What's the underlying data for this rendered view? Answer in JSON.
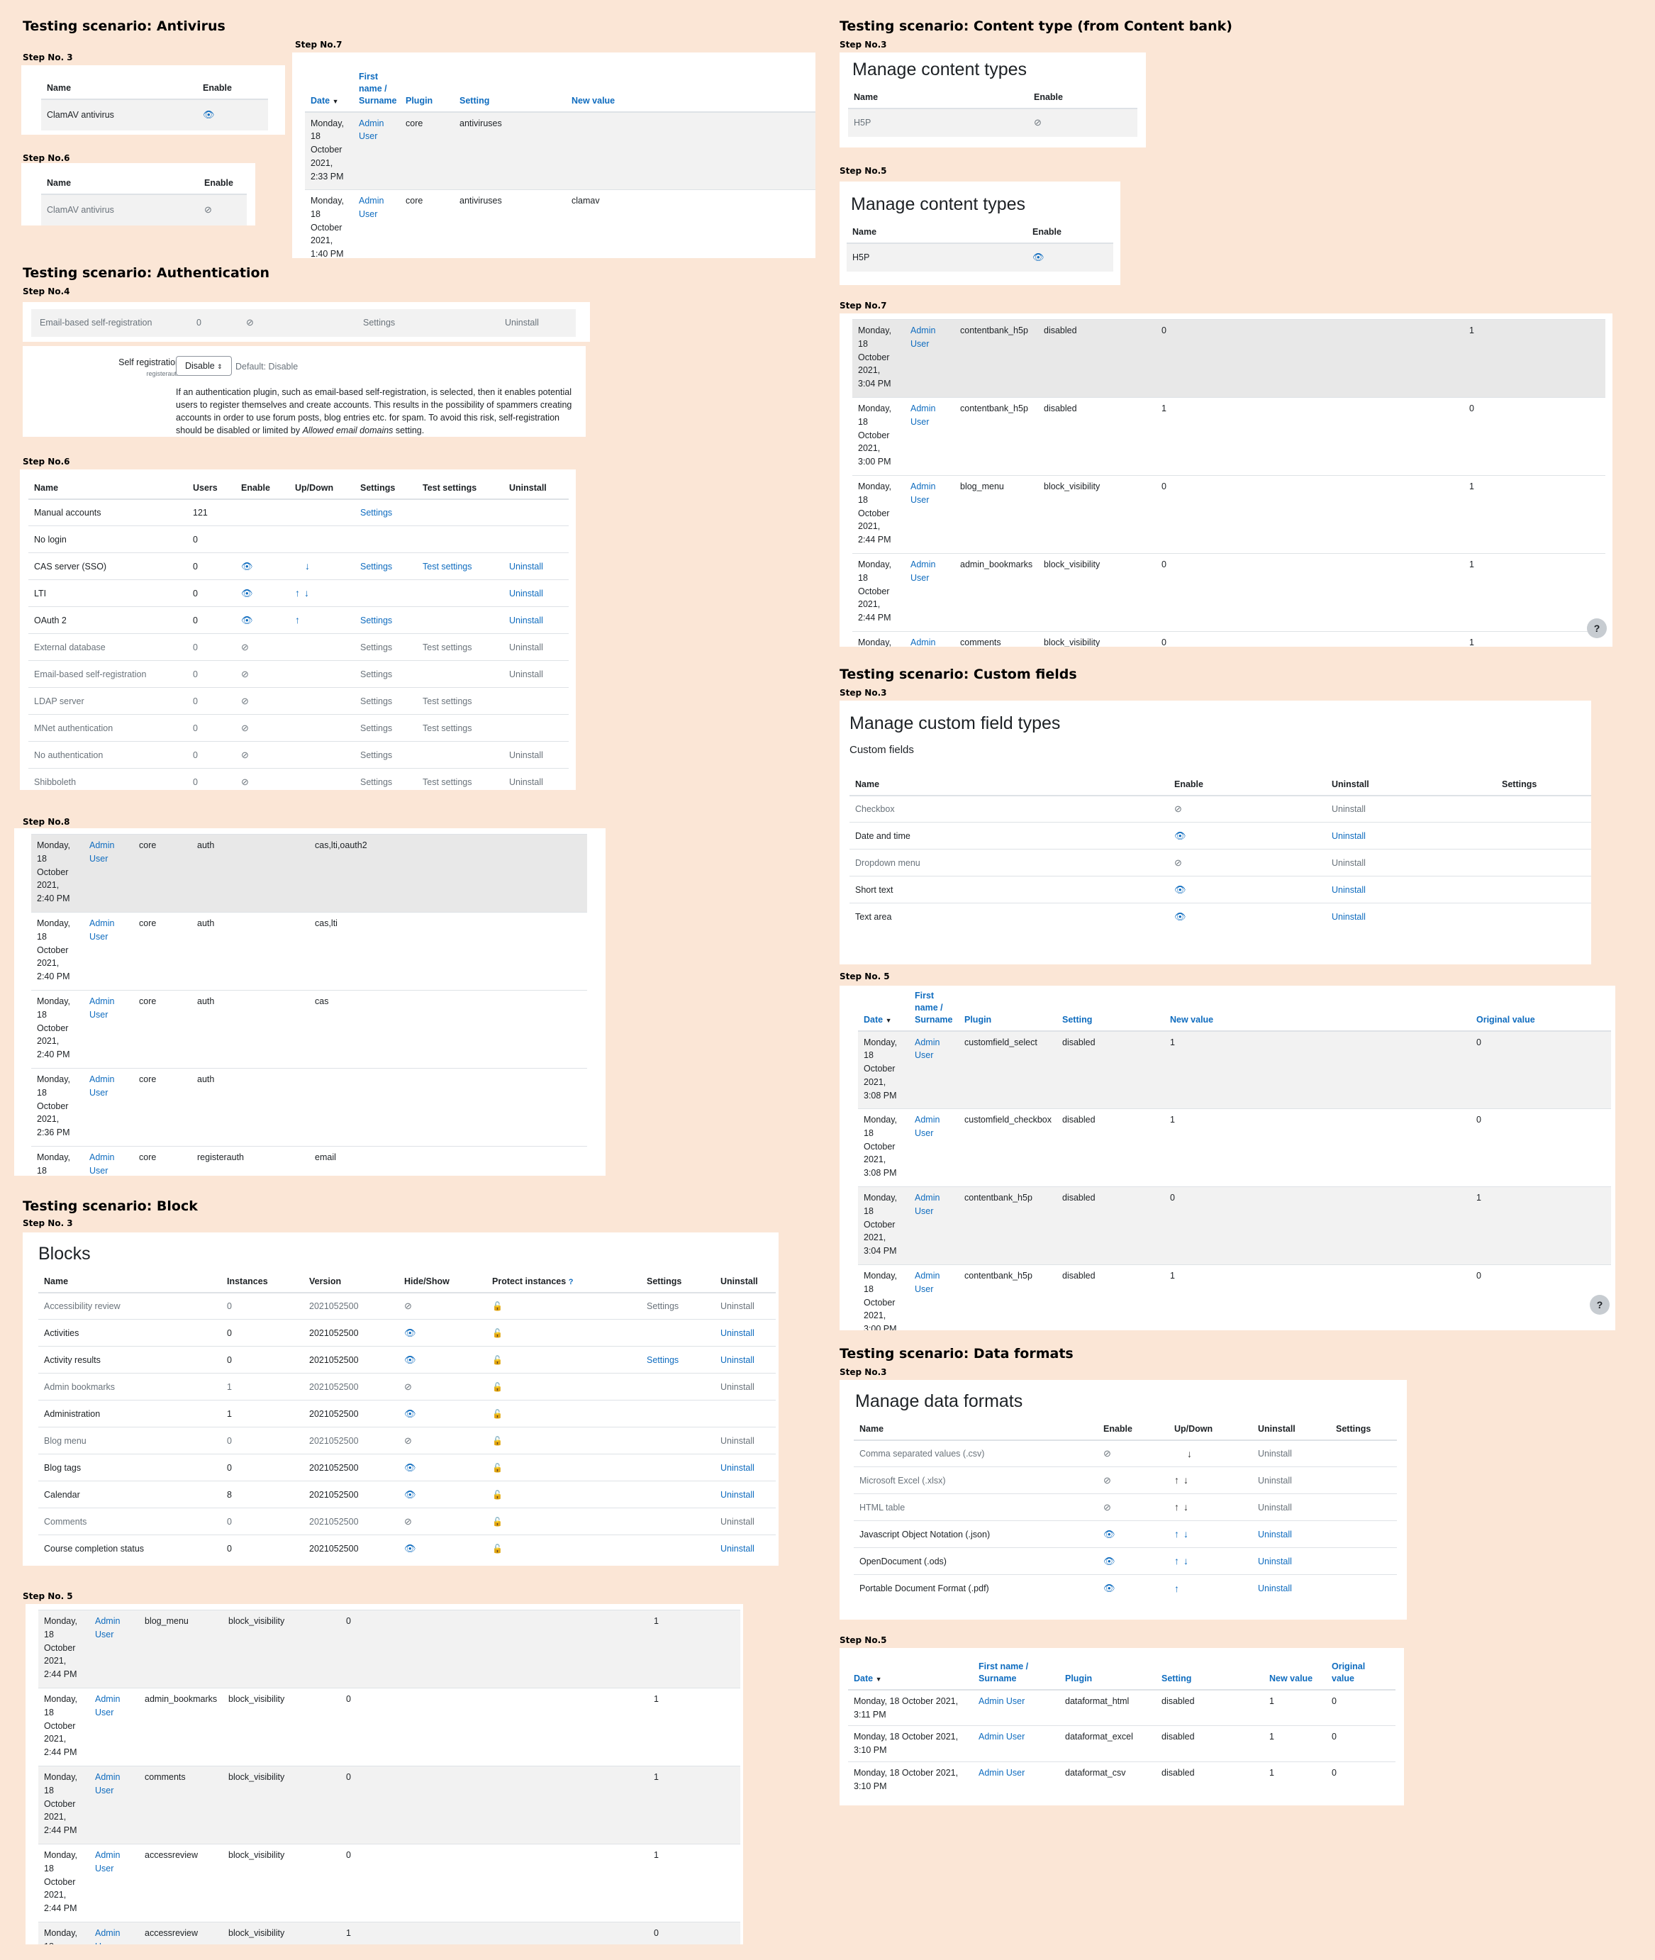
{
  "sections": {
    "antivirus": "Testing scenario: Antivirus",
    "auth": "Testing scenario: Authentication",
    "block": "Testing scenario: Block",
    "content": "Testing scenario: Content type (from Content bank)",
    "custom": "Testing scenario: Custom fields",
    "dataformats": "Testing scenario: Data formats"
  },
  "steps": {
    "av3": "Step No. 3",
    "av6": "Step No.6",
    "av7": "Step No.7",
    "au4": "Step No.4",
    "au6": "Step No.6",
    "au8": "Step No.8",
    "bl3": "Step No. 3",
    "bl5": "Step No. 5",
    "ct3": "Step No.3",
    "ct5": "Step No.5",
    "ct7": "Step No.7",
    "cf3": "Step No.3",
    "cf5": "Step No. 5",
    "df3": "Step No.3",
    "df5": "Step No.5"
  },
  "common": {
    "name": "Name",
    "enable": "Enable",
    "uninstall": "Uninstall",
    "settings": "Settings",
    "test_settings": "Test settings",
    "admin_user": "Admin User",
    "admin": "Admin",
    "user": "User",
    "monday": "Monday,",
    "day": "18",
    "month": "October",
    "year": "2021,",
    "help": "?"
  },
  "log_headers": {
    "date": "Date",
    "first_name": "First name / Surname",
    "plugin": "Plugin",
    "setting": "Setting",
    "new_value": "New value",
    "original_value": "Original value"
  },
  "antivirus": {
    "step3": {
      "row": "ClamAV antivirus"
    },
    "step6": {
      "row": "ClamAV antivirus"
    },
    "step7": {
      "rows": [
        {
          "time": "2:33 PM",
          "plugin": "core",
          "setting": "antiviruses",
          "value": ""
        },
        {
          "time": "1:40 PM",
          "plugin": "core",
          "setting": "antiviruses",
          "value": "clamav"
        }
      ]
    }
  },
  "auth": {
    "step4": {
      "name": "Email-based self-registration",
      "users": "0",
      "settings": "Settings",
      "uninstall": "Uninstall",
      "label": "Self registration",
      "sublabel": "registerauth",
      "select_value": "Disable",
      "default": "Default: Disable",
      "desc1": "If an authentication plugin, such as email-based self-registration, is selected, then it enables potential users to register themselves and create accounts. This results in the possibility of spammers creating accounts in order to use forum posts, blog entries etc. for spam. To avoid this risk, self-registration should be disabled or limited by",
      "desc_em": "Allowed email domains",
      "desc2": "setting."
    },
    "step6": {
      "headers": {
        "name": "Name",
        "users": "Users",
        "enable": "Enable",
        "updown": "Up/Down",
        "settings": "Settings",
        "test": "Test settings",
        "uninstall": "Uninstall"
      },
      "rows": [
        {
          "name": "Manual accounts",
          "users": "121"
        },
        {
          "name": "No login",
          "users": "0"
        },
        {
          "name": "CAS server (SSO)",
          "users": "0"
        },
        {
          "name": "LTI",
          "users": "0"
        },
        {
          "name": "OAuth 2",
          "users": "0"
        },
        {
          "name": "External database",
          "users": "0"
        },
        {
          "name": "Email-based self-registration",
          "users": "0"
        },
        {
          "name": "LDAP server",
          "users": "0"
        },
        {
          "name": "MNet authentication",
          "users": "0"
        },
        {
          "name": "No authentication",
          "users": "0"
        },
        {
          "name": "Shibboleth",
          "users": "0"
        }
      ]
    },
    "step8": {
      "rows": [
        {
          "time": "2:40 PM",
          "plugin": "core",
          "setting": "auth",
          "value": "cas,lti,oauth2"
        },
        {
          "time": "2:40 PM",
          "plugin": "core",
          "setting": "auth",
          "value": "cas,lti"
        },
        {
          "time": "2:40 PM",
          "plugin": "core",
          "setting": "auth",
          "value": "cas"
        },
        {
          "time": "2:36 PM",
          "plugin": "core",
          "setting": "auth",
          "value": ""
        },
        {
          "time": "",
          "plugin": "core",
          "setting": "registerauth",
          "value": "email"
        }
      ]
    }
  },
  "blocks": {
    "title": "Blocks",
    "headers": {
      "name": "Name",
      "instances": "Instances",
      "version": "Version",
      "hide": "Hide/Show",
      "protect": "Protect instances",
      "settings": "Settings",
      "uninstall": "Uninstall"
    },
    "rows": [
      {
        "name": "Accessibility review",
        "instances": "0",
        "version": "2021052500"
      },
      {
        "name": "Activities",
        "instances": "0",
        "version": "2021052500"
      },
      {
        "name": "Activity results",
        "instances": "0",
        "version": "2021052500"
      },
      {
        "name": "Admin bookmarks",
        "instances": "1",
        "version": "2021052500"
      },
      {
        "name": "Administration",
        "instances": "1",
        "version": "2021052500"
      },
      {
        "name": "Blog menu",
        "instances": "0",
        "version": "2021052500"
      },
      {
        "name": "Blog tags",
        "instances": "0",
        "version": "2021052500"
      },
      {
        "name": "Calendar",
        "instances": "8",
        "version": "2021052500"
      },
      {
        "name": "Comments",
        "instances": "0",
        "version": "2021052500"
      },
      {
        "name": "Course completion status",
        "instances": "0",
        "version": "2021052500"
      }
    ],
    "step5": {
      "rows": [
        {
          "time": "2:44 PM",
          "plugin": "blog_menu",
          "setting": "block_visibility",
          "new": "0",
          "orig": "1"
        },
        {
          "time": "2:44 PM",
          "plugin": "admin_bookmarks",
          "setting": "block_visibility",
          "new": "0",
          "orig": "1"
        },
        {
          "time": "2:44 PM",
          "plugin": "comments",
          "setting": "block_visibility",
          "new": "0",
          "orig": "1"
        },
        {
          "time": "2:44 PM",
          "plugin": "accessreview",
          "setting": "block_visibility",
          "new": "0",
          "orig": "1"
        },
        {
          "time": "",
          "plugin": "accessreview",
          "setting": "block_visibility",
          "new": "1",
          "orig": "0"
        }
      ]
    }
  },
  "content": {
    "title": "Manage content types",
    "row": "H5P",
    "step7": {
      "rows": [
        {
          "time": "3:04 PM",
          "plugin": "contentbank_h5p",
          "setting": "disabled",
          "new": "0",
          "orig": "1"
        },
        {
          "time": "3:00 PM",
          "plugin": "contentbank_h5p",
          "setting": "disabled",
          "new": "1",
          "orig": "0"
        },
        {
          "time": "2:44 PM",
          "plugin": "blog_menu",
          "setting": "block_visibility",
          "new": "0",
          "orig": "1"
        },
        {
          "time": "2:44 PM",
          "plugin": "admin_bookmarks",
          "setting": "block_visibility",
          "new": "0",
          "orig": "1"
        },
        {
          "time": "",
          "plugin": "comments",
          "setting": "block_visibility",
          "new": "0",
          "orig": "1"
        }
      ]
    }
  },
  "custom": {
    "title": "Manage custom field types",
    "subtitle": "Custom fields",
    "rows": [
      {
        "name": "Checkbox"
      },
      {
        "name": "Date and time"
      },
      {
        "name": "Dropdown menu"
      },
      {
        "name": "Short text"
      },
      {
        "name": "Text area"
      }
    ],
    "step5": {
      "rows": [
        {
          "time": "3:08 PM",
          "plugin": "customfield_select",
          "setting": "disabled",
          "new": "1",
          "orig": "0"
        },
        {
          "time": "3:08 PM",
          "plugin": "customfield_checkbox",
          "setting": "disabled",
          "new": "1",
          "orig": "0"
        },
        {
          "time": "3:04 PM",
          "plugin": "contentbank_h5p",
          "setting": "disabled",
          "new": "0",
          "orig": "1"
        },
        {
          "time": "3:00 PM",
          "plugin": "contentbank_h5p",
          "setting": "disabled",
          "new": "1",
          "orig": "0"
        }
      ]
    }
  },
  "dataformats": {
    "title": "Manage data formats",
    "headers": {
      "name": "Name",
      "enable": "Enable",
      "updown": "Up/Down",
      "uninstall": "Uninstall",
      "settings": "Settings"
    },
    "rows": [
      {
        "name": "Comma separated values (.csv)"
      },
      {
        "name": "Microsoft Excel (.xlsx)"
      },
      {
        "name": "HTML table"
      },
      {
        "name": "Javascript Object Notation (.json)"
      },
      {
        "name": "OpenDocument (.ods)"
      },
      {
        "name": "Portable Document Format (.pdf)"
      }
    ],
    "step5": {
      "rows": [
        {
          "date": "Monday, 18 October 2021,",
          "time": "3:11 PM",
          "plugin": "dataformat_html",
          "setting": "disabled",
          "new": "1",
          "orig": "0"
        },
        {
          "date": "Monday, 18 October 2021,",
          "time": "3:10 PM",
          "plugin": "dataformat_excel",
          "setting": "disabled",
          "new": "1",
          "orig": "0"
        },
        {
          "date": "Monday, 18 October 2021,",
          "time": "3:10 PM",
          "plugin": "dataformat_csv",
          "setting": "disabled",
          "new": "1",
          "orig": "0"
        }
      ]
    }
  }
}
